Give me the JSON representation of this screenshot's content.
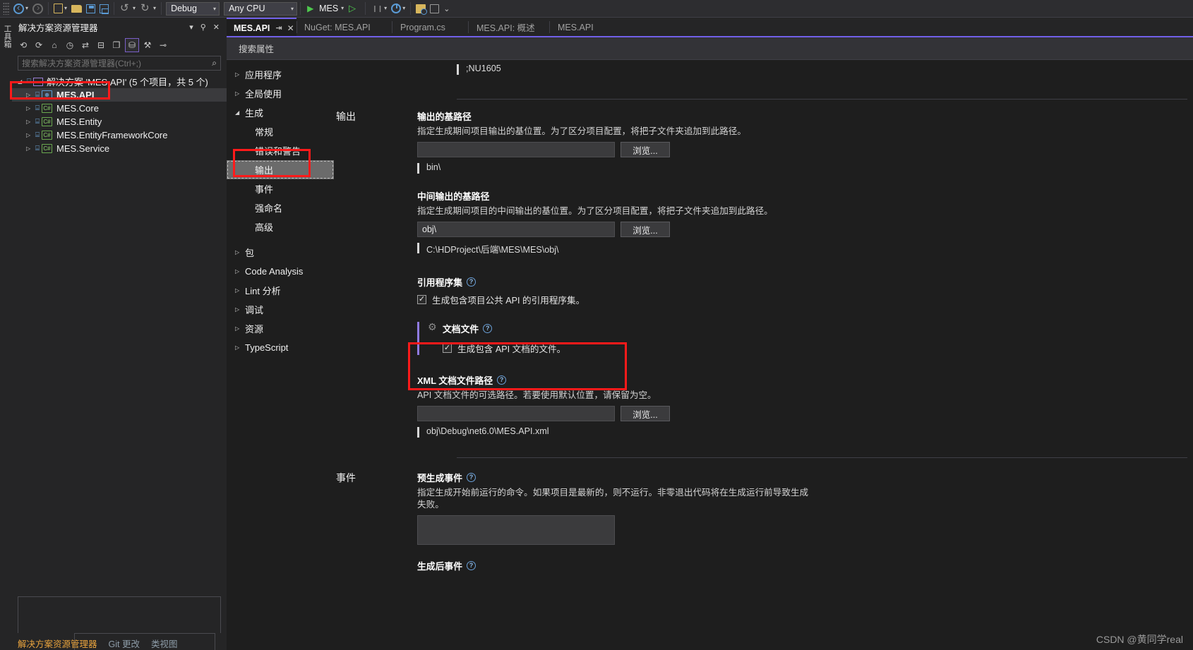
{
  "toolbar": {
    "config_combo": {
      "value": "Debug",
      "caret": "▾"
    },
    "platform_combo": {
      "value": "Any CPU",
      "caret": "▾"
    },
    "run_label": "MES",
    "caret": "▾"
  },
  "vertical_strip": {
    "label": "工具箱"
  },
  "solution_explorer": {
    "title": "解决方案资源管理器",
    "header_actions": [
      "▾",
      "⚲",
      "✕"
    ],
    "toolbar_buttons": [
      "⟲",
      "⟳",
      "⌂",
      "◷",
      "⇄",
      "⊟",
      "❐",
      "⛁",
      "⚒",
      "⊸"
    ],
    "search_placeholder": "搜索解决方案资源管理器(Ctrl+;)",
    "search_value": "",
    "search_icon": "⌕",
    "root": {
      "arrow": "◢",
      "label": "解决方案 'MES.API' (5 个项目，共 5 个)"
    },
    "items": [
      {
        "arrow": "▷",
        "lock": "🔒",
        "badge": "⊕",
        "badge_type": "web",
        "label": "MES.API",
        "selected": true
      },
      {
        "arrow": "▷",
        "lock": "🔒",
        "badge": "C#",
        "badge_type": "cs",
        "label": "MES.Core",
        "selected": false
      },
      {
        "arrow": "▷",
        "lock": "🔒",
        "badge": "C#",
        "badge_type": "cs",
        "label": "MES.Entity",
        "selected": false
      },
      {
        "arrow": "▷",
        "lock": "🔒",
        "badge": "C#",
        "badge_type": "cs",
        "label": "MES.EntityFrameworkCore",
        "selected": false
      },
      {
        "arrow": "▷",
        "lock": "🔒",
        "badge": "C#",
        "badge_type": "cs",
        "label": "MES.Service",
        "selected": false
      }
    ],
    "bottom_tabs": [
      {
        "label": "解决方案资源管理器",
        "active": true
      },
      {
        "label": "Git 更改",
        "active": false
      },
      {
        "label": "类视图",
        "active": false
      }
    ]
  },
  "editor_tabs": [
    {
      "label": "MES.API",
      "active": true,
      "pin": "⇥",
      "close": "✕"
    },
    {
      "label": "NuGet: MES.API",
      "active": false
    },
    {
      "label": "Program.cs",
      "active": false
    },
    {
      "label": "MES.API: 概述",
      "active": false
    },
    {
      "label": "MES.API",
      "active": false
    }
  ],
  "property_page": {
    "search_placeholder": "搜索属性",
    "nav": [
      {
        "label": "应用程序",
        "arrow": "▷",
        "level": 0,
        "selected": false
      },
      {
        "label": "全局使用",
        "arrow": "▷",
        "level": 0,
        "selected": false
      },
      {
        "label": "生成",
        "arrow": "◢",
        "level": 0,
        "selected": false
      },
      {
        "label": "常规",
        "arrow": "",
        "level": 1,
        "selected": false
      },
      {
        "label": "错误和警告",
        "arrow": "",
        "level": 1,
        "selected": false
      },
      {
        "label": "输出",
        "arrow": "",
        "level": 1,
        "selected": true
      },
      {
        "label": "事件",
        "arrow": "",
        "level": 1,
        "selected": false
      },
      {
        "label": "强命名",
        "arrow": "",
        "level": 1,
        "selected": false
      },
      {
        "label": "高级",
        "arrow": "",
        "level": 1,
        "selected": false
      },
      {
        "label": "包",
        "arrow": "▷",
        "level": 0,
        "selected": false
      },
      {
        "label": "Code Analysis",
        "arrow": "▷",
        "level": 0,
        "selected": false
      },
      {
        "label": "Lint 分析",
        "arrow": "▷",
        "level": 0,
        "selected": false
      },
      {
        "label": "调试",
        "arrow": "▷",
        "level": 0,
        "selected": false
      },
      {
        "label": "资源",
        "arrow": "▷",
        "level": 0,
        "selected": false
      },
      {
        "label": "TypeScript",
        "arrow": "▷",
        "level": 0,
        "selected": false
      }
    ],
    "top_note": ";NU1605",
    "sections": {
      "output": {
        "title": "输出",
        "base_path": {
          "label": "输出的基路径",
          "desc": "指定生成期间项目输出的基位置。为了区分项目配置，将把子文件夹追加到此路径。",
          "value": "",
          "browse": "浏览...",
          "note": "bin\\"
        },
        "intermediate_path": {
          "label": "中间输出的基路径",
          "desc": "指定生成期间项目的中间输出的基位置。为了区分项目配置，将把子文件夹追加到此路径。",
          "value": "obj\\",
          "browse": "浏览...",
          "note": "C:\\HDProject\\后端\\MES\\MES\\obj\\"
        },
        "reference_assembly": {
          "label": "引用程序集",
          "help": "?",
          "checkbox_label": "生成包含项目公共 API 的引用程序集。",
          "checked": true
        },
        "documentation_file": {
          "label": "文档文件",
          "help": "?",
          "gear_icon": "gear-icon",
          "checkbox_label": "生成包含 API 文档的文件。",
          "checked": true,
          "modified": true
        },
        "xml_doc_path": {
          "label": "XML 文档文件路径",
          "help": "?",
          "desc": "API 文档文件的可选路径。若要使用默认位置，请保留为空。",
          "value": "",
          "browse": "浏览...",
          "note": "obj\\Debug\\net6.0\\MES.API.xml"
        }
      },
      "events": {
        "title": "事件",
        "pre_build": {
          "label": "预生成事件",
          "help": "?",
          "desc": "指定生成开始前运行的命令。如果项目是最新的，则不运行。非零退出代码将在生成运行前导致生成失败。",
          "value": ""
        },
        "post_build": {
          "label": "生成后事件",
          "help": "?"
        }
      }
    }
  },
  "watermark": "CSDN @黄同学real"
}
